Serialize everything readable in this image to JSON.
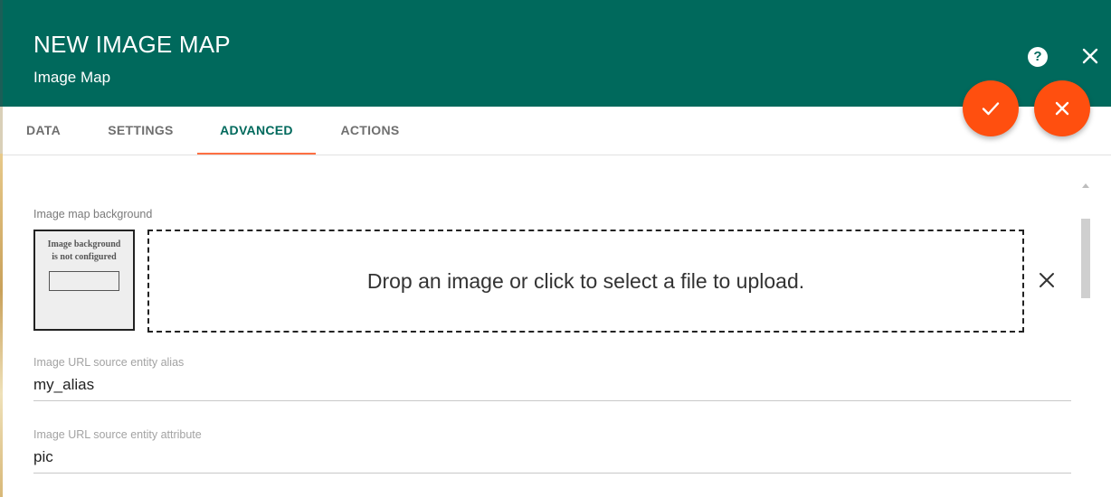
{
  "dialog": {
    "title": "NEW IMAGE MAP",
    "subtitle": "Image Map",
    "help_icon": "help-circle-icon",
    "close_icon": "close-icon"
  },
  "actions": {
    "confirm_icon": "check-icon",
    "cancel_icon": "close-icon",
    "accent_color": "#ff4f0f"
  },
  "tabs": [
    {
      "label": "DATA",
      "active": false
    },
    {
      "label": "SETTINGS",
      "active": false
    },
    {
      "label": "ADVANCED",
      "active": true
    },
    {
      "label": "ACTIONS",
      "active": false
    }
  ],
  "background": {
    "label": "Image map background",
    "preview_text_line1": "Image background",
    "preview_text_line2": "is not configured",
    "dropzone_text": "Drop an image or click to select a file to upload.",
    "clear_icon": "close-icon"
  },
  "fields": {
    "alias": {
      "label": "Image URL source entity alias",
      "value": "my_alias"
    },
    "attribute": {
      "label": "Image URL source entity attribute",
      "value": "pic"
    }
  },
  "colors": {
    "header": "#00695c",
    "active_tab_text": "#00695c",
    "active_tab_indicator": "#ff7043"
  }
}
